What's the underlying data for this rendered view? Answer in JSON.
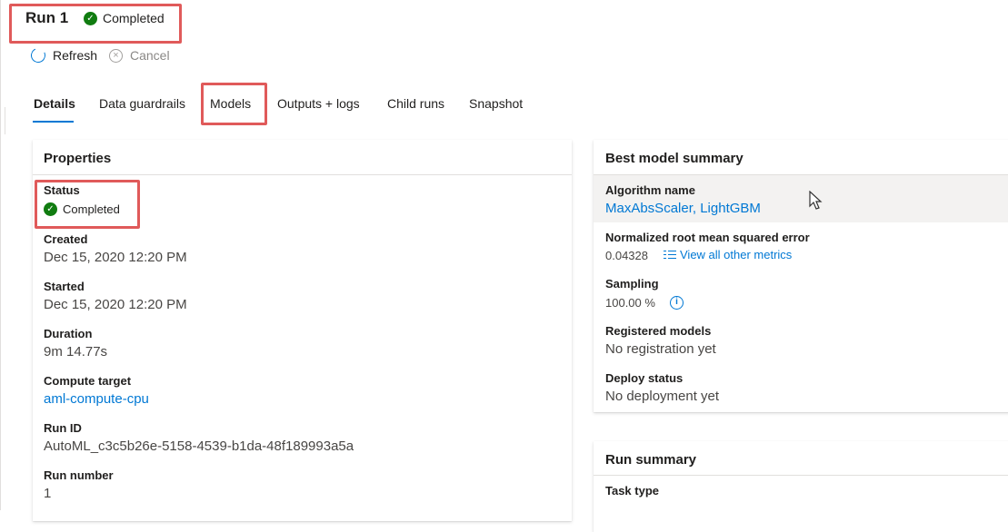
{
  "header": {
    "run_title": "Run 1",
    "status": "Completed"
  },
  "toolbar": {
    "refresh_label": "Refresh",
    "cancel_label": "Cancel"
  },
  "tabs": [
    {
      "label": "Details",
      "active": true
    },
    {
      "label": "Data guardrails",
      "active": false
    },
    {
      "label": "Models",
      "active": false
    },
    {
      "label": "Outputs + logs",
      "active": false
    },
    {
      "label": "Child runs",
      "active": false
    },
    {
      "label": "Snapshot",
      "active": false
    }
  ],
  "properties": {
    "title": "Properties",
    "status_label": "Status",
    "status_value": "Completed",
    "created_label": "Created",
    "created_value": "Dec 15, 2020 12:20 PM",
    "started_label": "Started",
    "started_value": "Dec 15, 2020 12:20 PM",
    "duration_label": "Duration",
    "duration_value": "9m 14.77s",
    "compute_label": "Compute target",
    "compute_value": "aml-compute-cpu",
    "run_id_label": "Run ID",
    "run_id_value": "AutoML_c3c5b26e-5158-4539-b1da-48f189993a5a",
    "run_number_label": "Run number",
    "run_number_value": "1"
  },
  "best_model": {
    "title": "Best model summary",
    "algorithm_label": "Algorithm name",
    "algorithm_value": "MaxAbsScaler, LightGBM",
    "metric_label": "Normalized root mean squared error",
    "metric_value": "0.04328",
    "view_metrics_label": "View all other metrics",
    "sampling_label": "Sampling",
    "sampling_value": "100.00 %",
    "registered_label": "Registered models",
    "registered_value": "No registration yet",
    "deploy_label": "Deploy status",
    "deploy_value": "No deployment yet"
  },
  "run_summary": {
    "title": "Run summary",
    "task_type_label": "Task type"
  },
  "colors": {
    "accent": "#0078d4",
    "success": "#107c10",
    "highlight_annotation": "#e05a5a"
  }
}
